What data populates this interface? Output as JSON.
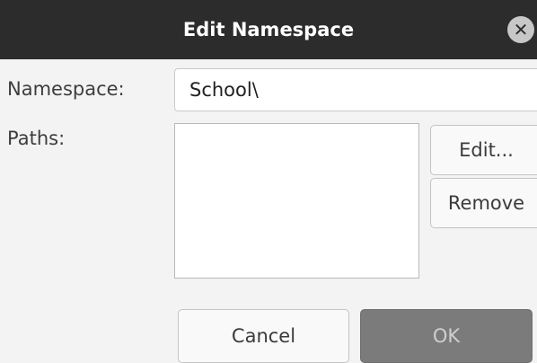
{
  "dialog": {
    "title": "Edit Namespace",
    "close_icon": "close-icon"
  },
  "form": {
    "namespace_label": "Namespace:",
    "namespace_value": "School\\",
    "paths_label": "Paths:",
    "paths_items": []
  },
  "side_buttons": {
    "edit_label": "Edit...",
    "remove_label": "Remove"
  },
  "footer": {
    "cancel_label": "Cancel",
    "ok_label": "OK"
  }
}
